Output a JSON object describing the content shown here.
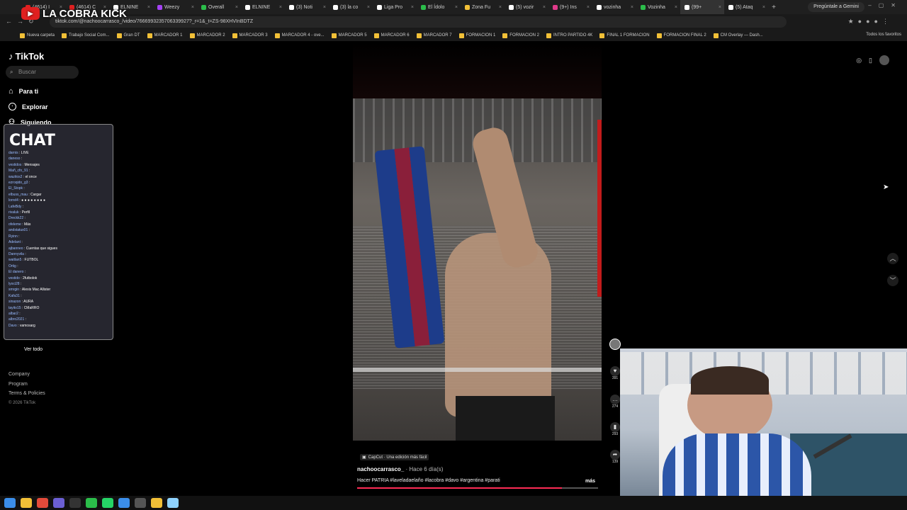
{
  "browser": {
    "tabs": [
      {
        "label": "(4614) I",
        "color": "#e02020"
      },
      {
        "label": "(4614) C",
        "color": "#e02020"
      },
      {
        "label": "ELNINE",
        "color": "#ffffff"
      },
      {
        "label": "Weezy",
        "color": "#a542f5"
      },
      {
        "label": "Overall",
        "color": "#2bbd4a"
      },
      {
        "label": "ELNINE",
        "color": "#ffffff"
      },
      {
        "label": "(3) Noti",
        "color": "#ffffff"
      },
      {
        "label": "(3) la co",
        "color": "#ffffff"
      },
      {
        "label": "Liga Pro",
        "color": "#ffffff"
      },
      {
        "label": "El Ídolo",
        "color": "#2bbd4a"
      },
      {
        "label": "Zona Fu",
        "color": "#f2c037"
      },
      {
        "label": "(5) vozir",
        "color": "#ffffff"
      },
      {
        "label": "(9+) Ins",
        "color": "#e03a8a"
      },
      {
        "label": "vozinha",
        "color": "#ffffff"
      },
      {
        "label": "Vozinha",
        "color": "#2bbd4a"
      },
      {
        "label": "(99+",
        "color": "#ffffff",
        "active": true
      },
      {
        "label": "(5) Ataq",
        "color": "#ffffff"
      }
    ],
    "new_tab": "+",
    "gemini": "Pregúntale a Gemini",
    "url": "tiktok.com/@nachoocarrasco_/video/7666993235706339927?_r=1&_t=ZS-98XHVInBDTZ",
    "bookmarks": [
      "Nueva carpeta",
      "Trabajo Social Com...",
      "Gran DT",
      "MARCADOR 1",
      "MARCADOR 2",
      "MARCADOR 3",
      "MARCADOR 4 - ove...",
      "MARCADOR 5",
      "MARCADOR 6",
      "MARCADOR 7",
      "FORMACION 1",
      "FORMACION 2",
      "INTRO PARTIDO 4K",
      "FINAL 1 FORMACION",
      "FORMACION FINAL 2",
      "CM Overlay — Dash..."
    ],
    "bookmarks_right": "Todos los favoritos"
  },
  "stream": {
    "title": "LA COBRA KICK"
  },
  "tiktok": {
    "logo": "TikTok",
    "search_placeholder": "Buscar",
    "nav": [
      "Para ti",
      "Explorar",
      "Siguiendo"
    ],
    "ver_todo": "Ver todo",
    "footer": [
      "Company",
      "Program",
      "Terms & Policies"
    ],
    "copyright": "© 2026 TikTok"
  },
  "chat": {
    "title": "CHAT",
    "lines": [
      {
        "user": "darnis",
        "msg": "LIVE"
      },
      {
        "user": "daneso",
        "msg": ""
      },
      {
        "user": "vestidos",
        "msg": "Mensajes"
      },
      {
        "user": "Mañ_cfo_91",
        "msg": ""
      },
      {
        "user": "wazitos2",
        "msg": "el once"
      },
      {
        "user": "ezroqido_g3",
        "msg": ""
      },
      {
        "user": "El_Stopk",
        "msg": ""
      },
      {
        "user": "elbuss_mau",
        "msg": "Cargar"
      },
      {
        "user": "lorrel4",
        "msg": "● ● ● ● ● ● ● ●"
      },
      {
        "user": "LafeBdy",
        "msg": ""
      },
      {
        "user": "rivaluk",
        "msg": "Perfil"
      },
      {
        "user": "Dreckk22",
        "msg": ""
      },
      {
        "user": "ofeleme",
        "msg": "Más"
      },
      {
        "user": "andstatus01",
        "msg": ""
      },
      {
        "user": "Ryinn",
        "msg": ""
      },
      {
        "user": "Adelant",
        "msg": ""
      },
      {
        "user": "ajbanneo",
        "msg": "Cuentas que sigues"
      },
      {
        "user": "Dannyvila",
        "msg": ""
      },
      {
        "user": "waitlan5",
        "msg": "FUTBOL"
      },
      {
        "user": "Ortig",
        "msg": ""
      },
      {
        "user": "El danero",
        "msg": ""
      },
      {
        "user": "vestido",
        "msg": "2futbolok"
      },
      {
        "user": "lyoci28",
        "msg": ""
      },
      {
        "user": "smrgin",
        "msg": "Alexis Mac Allister"
      },
      {
        "user": "Kafa31",
        "msg": ""
      },
      {
        "user": "sinazon",
        "msg": "AURA"
      },
      {
        "user": "tayito15",
        "msg": "CMaRRO"
      },
      {
        "user": "albar2",
        "msg": ""
      },
      {
        "user": "albro2021",
        "msg": ""
      },
      {
        "user": "Davo",
        "msg": "vamosarg"
      }
    ]
  },
  "video": {
    "capcut": "CapCut · Una edición más fácil",
    "author": "nachoocarrasco_",
    "date": "· Hace 6 día(s)",
    "caption": "Hacer PATRIA #laveladaelaño #lacobra #davo #argentina #parati",
    "more": "más",
    "progress": 0.85,
    "actions": [
      {
        "icon": "heart-icon",
        "count": "391"
      },
      {
        "icon": "comment-icon",
        "count": "274"
      },
      {
        "icon": "bookmark-icon",
        "count": "293"
      },
      {
        "icon": "share-icon",
        "count": "139"
      }
    ]
  },
  "taskbar": {
    "icons": [
      "windows-icon",
      "explorer-icon",
      "chrome-icon",
      "teams-icon",
      "obs-icon",
      "app-icon",
      "whatsapp-icon",
      "store-icon",
      "terminal-icon",
      "files-icon",
      "active-app-icon"
    ]
  }
}
